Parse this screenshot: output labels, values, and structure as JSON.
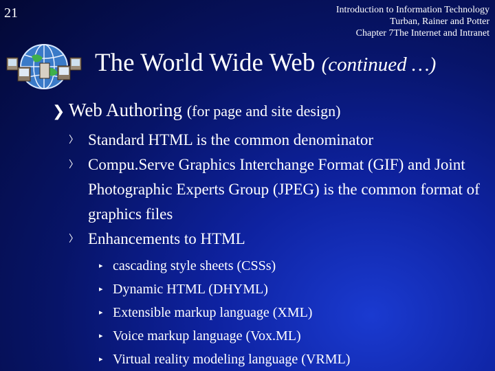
{
  "slide_number": "21",
  "header": {
    "line1": "Introduction to Information Technology",
    "line2": "Turban, Rainer and Potter",
    "line3": "Chapter 7The Internet and Intranet"
  },
  "title": {
    "main": "The World Wide Web",
    "continued": "(continued …)"
  },
  "bullet": {
    "label": "Web Authoring",
    "note": "(for page and site design)"
  },
  "level2": [
    "Standard HTML is the common denominator",
    "Compu.Serve Graphics Interchange Format (GIF)  and Joint Photographic Experts Group (JPEG) is the common format of graphics files",
    "Enhancements to HTML"
  ],
  "level3": [
    "cascading style sheets (CSSs)",
    "Dynamic HTML (DHYML)",
    "Extensible markup language (XML)",
    "Voice markup language (Vox.ML)",
    "Virtual reality modeling language (VRML)"
  ],
  "icons": {
    "logo": "globe-network-icon",
    "main_bullet": "chevron-right-icon",
    "sub_bullet": "chevron-outline-icon",
    "small_bullet": "triangle-right-icon"
  },
  "colors": {
    "background": "#0e22a0",
    "text": "#ffffff"
  }
}
